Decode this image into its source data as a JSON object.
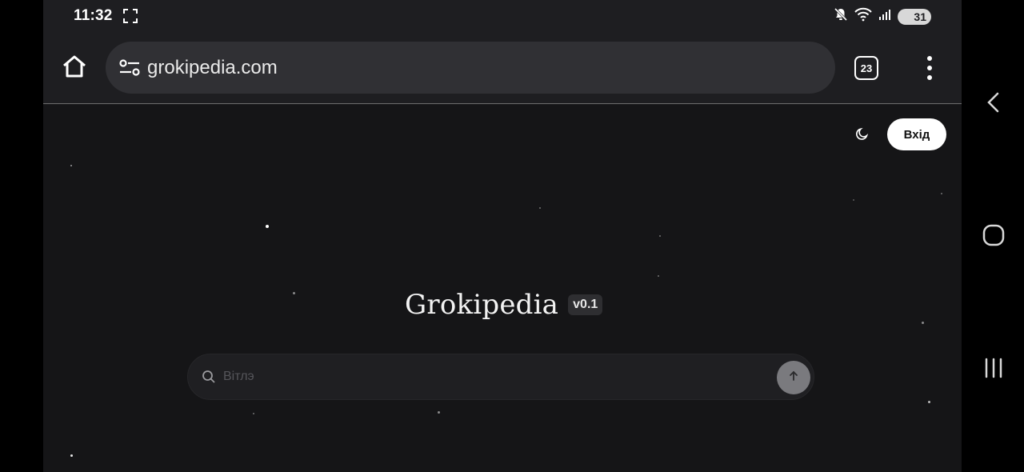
{
  "status_bar": {
    "time": "11:32",
    "battery": "31",
    "icons": [
      "screenshot-icon",
      "mute-icon",
      "wifi-icon",
      "signal-icon",
      "battery-icon"
    ]
  },
  "browser": {
    "url": "grokipedia.com",
    "tab_count": "23",
    "icons": [
      "home-icon",
      "site-settings-icon",
      "tabs-icon",
      "more-menu-icon"
    ]
  },
  "page": {
    "login_label": "Вхід",
    "title": "Grokipedia",
    "version": "v0.1",
    "search_placeholder": "Вітлэ",
    "search_value": "",
    "icons": [
      "moon-icon",
      "search-icon",
      "arrow-up-icon"
    ]
  },
  "system_nav": {
    "icons": [
      "back-icon",
      "home-circle-icon",
      "recents-icon"
    ]
  },
  "colors": {
    "page_bg": "#151517",
    "toolbar_bg": "#1e1e21",
    "url_bar_bg": "#303034",
    "submit_bg": "#7a7a7e"
  }
}
